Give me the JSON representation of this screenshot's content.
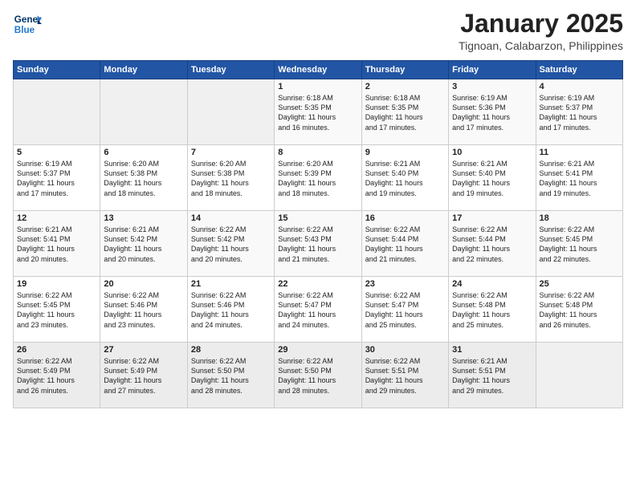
{
  "logo": {
    "line1": "General",
    "line2": "Blue"
  },
  "title": "January 2025",
  "subtitle": "Tignoan, Calabarzon, Philippines",
  "weekdays": [
    "Sunday",
    "Monday",
    "Tuesday",
    "Wednesday",
    "Thursday",
    "Friday",
    "Saturday"
  ],
  "weeks": [
    [
      {
        "day": "",
        "info": ""
      },
      {
        "day": "",
        "info": ""
      },
      {
        "day": "",
        "info": ""
      },
      {
        "day": "1",
        "info": "Sunrise: 6:18 AM\nSunset: 5:35 PM\nDaylight: 11 hours\nand 16 minutes."
      },
      {
        "day": "2",
        "info": "Sunrise: 6:18 AM\nSunset: 5:35 PM\nDaylight: 11 hours\nand 17 minutes."
      },
      {
        "day": "3",
        "info": "Sunrise: 6:19 AM\nSunset: 5:36 PM\nDaylight: 11 hours\nand 17 minutes."
      },
      {
        "day": "4",
        "info": "Sunrise: 6:19 AM\nSunset: 5:37 PM\nDaylight: 11 hours\nand 17 minutes."
      }
    ],
    [
      {
        "day": "5",
        "info": "Sunrise: 6:19 AM\nSunset: 5:37 PM\nDaylight: 11 hours\nand 17 minutes."
      },
      {
        "day": "6",
        "info": "Sunrise: 6:20 AM\nSunset: 5:38 PM\nDaylight: 11 hours\nand 18 minutes."
      },
      {
        "day": "7",
        "info": "Sunrise: 6:20 AM\nSunset: 5:38 PM\nDaylight: 11 hours\nand 18 minutes."
      },
      {
        "day": "8",
        "info": "Sunrise: 6:20 AM\nSunset: 5:39 PM\nDaylight: 11 hours\nand 18 minutes."
      },
      {
        "day": "9",
        "info": "Sunrise: 6:21 AM\nSunset: 5:40 PM\nDaylight: 11 hours\nand 19 minutes."
      },
      {
        "day": "10",
        "info": "Sunrise: 6:21 AM\nSunset: 5:40 PM\nDaylight: 11 hours\nand 19 minutes."
      },
      {
        "day": "11",
        "info": "Sunrise: 6:21 AM\nSunset: 5:41 PM\nDaylight: 11 hours\nand 19 minutes."
      }
    ],
    [
      {
        "day": "12",
        "info": "Sunrise: 6:21 AM\nSunset: 5:41 PM\nDaylight: 11 hours\nand 20 minutes."
      },
      {
        "day": "13",
        "info": "Sunrise: 6:21 AM\nSunset: 5:42 PM\nDaylight: 11 hours\nand 20 minutes."
      },
      {
        "day": "14",
        "info": "Sunrise: 6:22 AM\nSunset: 5:42 PM\nDaylight: 11 hours\nand 20 minutes."
      },
      {
        "day": "15",
        "info": "Sunrise: 6:22 AM\nSunset: 5:43 PM\nDaylight: 11 hours\nand 21 minutes."
      },
      {
        "day": "16",
        "info": "Sunrise: 6:22 AM\nSunset: 5:44 PM\nDaylight: 11 hours\nand 21 minutes."
      },
      {
        "day": "17",
        "info": "Sunrise: 6:22 AM\nSunset: 5:44 PM\nDaylight: 11 hours\nand 22 minutes."
      },
      {
        "day": "18",
        "info": "Sunrise: 6:22 AM\nSunset: 5:45 PM\nDaylight: 11 hours\nand 22 minutes."
      }
    ],
    [
      {
        "day": "19",
        "info": "Sunrise: 6:22 AM\nSunset: 5:45 PM\nDaylight: 11 hours\nand 23 minutes."
      },
      {
        "day": "20",
        "info": "Sunrise: 6:22 AM\nSunset: 5:46 PM\nDaylight: 11 hours\nand 23 minutes."
      },
      {
        "day": "21",
        "info": "Sunrise: 6:22 AM\nSunset: 5:46 PM\nDaylight: 11 hours\nand 24 minutes."
      },
      {
        "day": "22",
        "info": "Sunrise: 6:22 AM\nSunset: 5:47 PM\nDaylight: 11 hours\nand 24 minutes."
      },
      {
        "day": "23",
        "info": "Sunrise: 6:22 AM\nSunset: 5:47 PM\nDaylight: 11 hours\nand 25 minutes."
      },
      {
        "day": "24",
        "info": "Sunrise: 6:22 AM\nSunset: 5:48 PM\nDaylight: 11 hours\nand 25 minutes."
      },
      {
        "day": "25",
        "info": "Sunrise: 6:22 AM\nSunset: 5:48 PM\nDaylight: 11 hours\nand 26 minutes."
      }
    ],
    [
      {
        "day": "26",
        "info": "Sunrise: 6:22 AM\nSunset: 5:49 PM\nDaylight: 11 hours\nand 26 minutes."
      },
      {
        "day": "27",
        "info": "Sunrise: 6:22 AM\nSunset: 5:49 PM\nDaylight: 11 hours\nand 27 minutes."
      },
      {
        "day": "28",
        "info": "Sunrise: 6:22 AM\nSunset: 5:50 PM\nDaylight: 11 hours\nand 28 minutes."
      },
      {
        "day": "29",
        "info": "Sunrise: 6:22 AM\nSunset: 5:50 PM\nDaylight: 11 hours\nand 28 minutes."
      },
      {
        "day": "30",
        "info": "Sunrise: 6:22 AM\nSunset: 5:51 PM\nDaylight: 11 hours\nand 29 minutes."
      },
      {
        "day": "31",
        "info": "Sunrise: 6:21 AM\nSunset: 5:51 PM\nDaylight: 11 hours\nand 29 minutes."
      },
      {
        "day": "",
        "info": ""
      }
    ]
  ]
}
